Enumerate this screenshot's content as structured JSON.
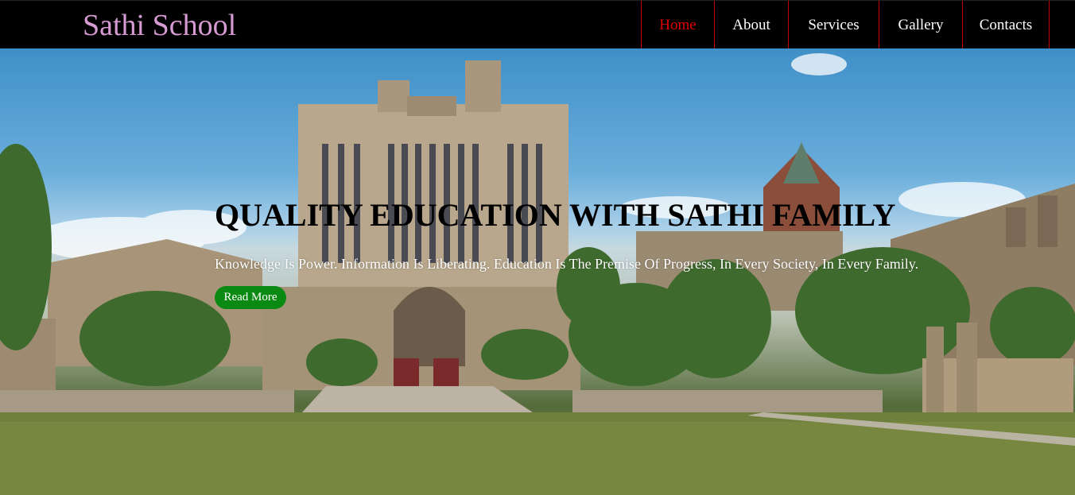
{
  "brand": {
    "name": "Sathi School"
  },
  "nav": {
    "items": [
      {
        "label": "Home",
        "active": true
      },
      {
        "label": "About",
        "active": false
      },
      {
        "label": "Services",
        "active": false
      },
      {
        "label": "Gallery",
        "active": false
      },
      {
        "label": "Contacts",
        "active": false
      }
    ]
  },
  "hero": {
    "title": "QUALITY EDUCATION WITH SATHI FAMILY",
    "subtitle": "Knowledge Is Power. Information Is Liberating. Education Is The Premise Of Progress, In Every Society, In Every Family.",
    "button_label": "Read More",
    "image_description": "university gothic tower building with lawn"
  },
  "colors": {
    "navbar_bg": "#000000",
    "brand": "#d69bd2",
    "nav_text": "#ffffff",
    "nav_active": "#e00000",
    "nav_divider": "#c40000",
    "button_bg": "#0a8a12"
  }
}
